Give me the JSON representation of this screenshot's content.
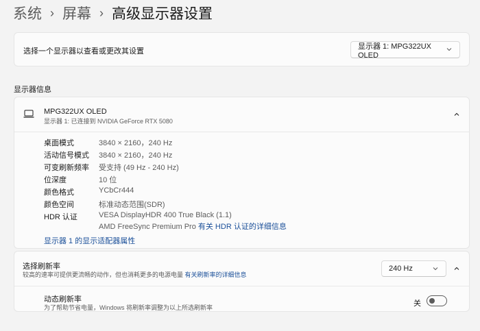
{
  "breadcrumb": {
    "items": [
      "系统",
      "屏幕"
    ],
    "current": "高级显示器设置"
  },
  "select_monitor": {
    "label": "选择一个显示器以查看或更改其设置",
    "dropdown_value": "显示器 1: MPG322UX OLED"
  },
  "section_title": "显示器信息",
  "monitor": {
    "name": "MPG322UX OLED",
    "subtitle": "显示器 1: 已连接到 NVIDIA GeForce RTX 5080",
    "properties": [
      {
        "key": "桌面模式",
        "value": "3840 × 2160，240 Hz"
      },
      {
        "key": "活动信号模式",
        "value": "3840 × 2160，240 Hz"
      },
      {
        "key": "可变刷新频率",
        "value": "受支持 (49 Hz - 240 Hz)"
      },
      {
        "key": "位深度",
        "value": "10 位"
      },
      {
        "key": "颜色格式",
        "value": "YCbCr444"
      },
      {
        "key": "颜色空间",
        "value": "标准动态范围(SDR)"
      },
      {
        "key": "HDR 认证",
        "value": "VESA DisplayHDR 400 True Black (1.1)",
        "value2": "AMD FreeSync Premium Pro",
        "link": "有关 HDR 认证的详细信息"
      }
    ],
    "adapter_link": "显示器 1 的显示适配器属性"
  },
  "refresh": {
    "title": "选择刷新率",
    "description": "较高的速率可提供更流畅的动作，但也消耗更多的电源电量",
    "description_link": "有关刷新率的详细信息",
    "value": "240 Hz",
    "dynamic": {
      "title": "动态刷新率",
      "description": "为了帮助节省电量，Windows 将刷新率调整为以上所选刷新率",
      "toggle_label": "关",
      "toggle_on": false
    }
  },
  "colors": {
    "accent_link": "#1a4f99",
    "background": "#f3f3f3",
    "card": "#fbfbfb"
  }
}
